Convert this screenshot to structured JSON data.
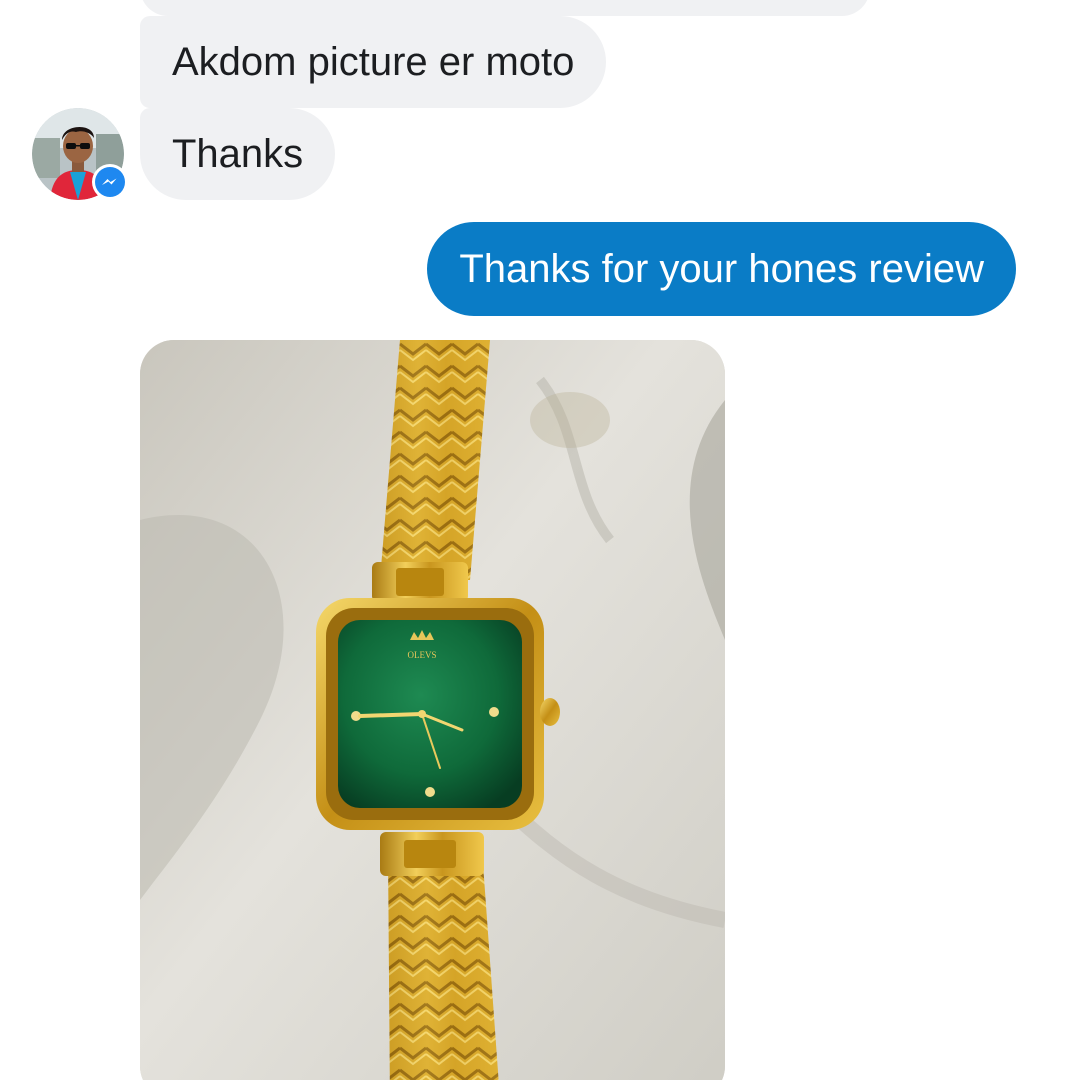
{
  "conversation": {
    "incoming": [
      {
        "text": "Akdom picture er moto"
      },
      {
        "text": "Thanks"
      }
    ],
    "outgoing": [
      {
        "text": "Thanks for your hones review"
      }
    ],
    "photo_message": {
      "subject": "gold square wristwatch with green dial",
      "dial_brand": "OLEVS"
    }
  },
  "contact": {
    "avatar_icon": "profile-photo",
    "badge_icon": "messenger-icon"
  },
  "colors": {
    "incoming_bubble": "#f0f1f3",
    "outgoing_bubble": "#0a7cc6",
    "messenger_badge": "#1e88f0",
    "dial_green": "#0f6a3a",
    "gold": "#d4a52a"
  }
}
